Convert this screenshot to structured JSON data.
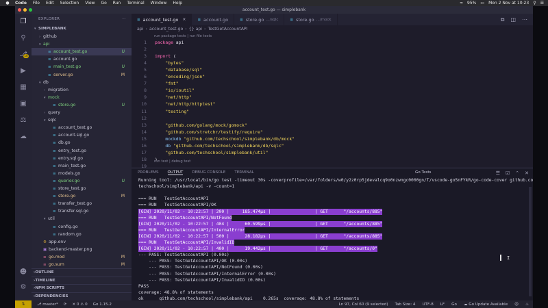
{
  "menubar": {
    "apple_icon": "apple-icon",
    "items": [
      "Code",
      "File",
      "Edit",
      "Selection",
      "View",
      "Go",
      "Run",
      "Terminal",
      "Window",
      "Help"
    ],
    "clock": "Mon 2 Nov at 10:23",
    "battery": "95%"
  },
  "window": {
    "title": "account_test.go — simplebank"
  },
  "sidebar": {
    "title": "EXPLORER",
    "project": "SIMPLEBANK",
    "rows": [
      {
        "label": "github",
        "kind": "folder",
        "open": false,
        "depth": 1,
        "status": ""
      },
      {
        "label": "api",
        "kind": "folder",
        "open": true,
        "depth": 1,
        "status": "",
        "color": "#7fd17f"
      },
      {
        "label": "account_test.go",
        "kind": "go",
        "open": false,
        "depth": 2,
        "status": "U",
        "color": "#7fd17f",
        "selected": true
      },
      {
        "label": "account.go",
        "kind": "go",
        "open": false,
        "depth": 2,
        "status": ""
      },
      {
        "label": "main_test.go",
        "kind": "go",
        "open": false,
        "depth": 2,
        "status": "U",
        "color": "#7fd17f"
      },
      {
        "label": "server.go",
        "kind": "go",
        "open": false,
        "depth": 2,
        "status": "M",
        "color": "#e2c08d"
      },
      {
        "label": "db",
        "kind": "folder",
        "open": true,
        "depth": 1,
        "status": ""
      },
      {
        "label": "migration",
        "kind": "folder",
        "open": false,
        "depth": 2,
        "status": ""
      },
      {
        "label": "mock",
        "kind": "folder",
        "open": true,
        "depth": 2,
        "status": "",
        "color": "#7fd17f"
      },
      {
        "label": "store.go",
        "kind": "go",
        "open": false,
        "depth": 3,
        "status": "U",
        "color": "#7fd17f"
      },
      {
        "label": "query",
        "kind": "folder",
        "open": false,
        "depth": 2,
        "status": ""
      },
      {
        "label": "sqlc",
        "kind": "folder",
        "open": true,
        "depth": 2,
        "status": ""
      },
      {
        "label": "account_test.go",
        "kind": "go",
        "open": false,
        "depth": 3,
        "status": ""
      },
      {
        "label": "account.sql.go",
        "kind": "go",
        "open": false,
        "depth": 3,
        "status": ""
      },
      {
        "label": "db.go",
        "kind": "go",
        "open": false,
        "depth": 3,
        "status": ""
      },
      {
        "label": "entry_test.go",
        "kind": "go",
        "open": false,
        "depth": 3,
        "status": ""
      },
      {
        "label": "entry.sql.go",
        "kind": "go",
        "open": false,
        "depth": 3,
        "status": ""
      },
      {
        "label": "main_test.go",
        "kind": "go",
        "open": false,
        "depth": 3,
        "status": ""
      },
      {
        "label": "models.go",
        "kind": "go",
        "open": false,
        "depth": 3,
        "status": ""
      },
      {
        "label": "querier.go",
        "kind": "go",
        "open": false,
        "depth": 3,
        "status": "U",
        "color": "#7fd17f"
      },
      {
        "label": "store_test.go",
        "kind": "go",
        "open": false,
        "depth": 3,
        "status": ""
      },
      {
        "label": "store.go",
        "kind": "go",
        "open": false,
        "depth": 3,
        "status": "M",
        "color": "#e2c08d"
      },
      {
        "label": "transfer_test.go",
        "kind": "go",
        "open": false,
        "depth": 3,
        "status": ""
      },
      {
        "label": "transfer.sql.go",
        "kind": "go",
        "open": false,
        "depth": 3,
        "status": ""
      },
      {
        "label": "util",
        "kind": "folder",
        "open": true,
        "depth": 2,
        "status": ""
      },
      {
        "label": "config.go",
        "kind": "go",
        "open": false,
        "depth": 3,
        "status": ""
      },
      {
        "label": "random.go",
        "kind": "go",
        "open": false,
        "depth": 3,
        "status": ""
      },
      {
        "label": "app.env",
        "kind": "env",
        "open": false,
        "depth": 1,
        "status": ""
      },
      {
        "label": "backend-master.png",
        "kind": "img",
        "open": false,
        "depth": 1,
        "status": ""
      },
      {
        "label": "go.mod",
        "kind": "mod",
        "open": false,
        "depth": 1,
        "status": "M",
        "color": "#e2c08d"
      },
      {
        "label": "go.sum",
        "kind": "mod",
        "open": false,
        "depth": 1,
        "status": "M",
        "color": "#e2c08d"
      }
    ],
    "sections": [
      "OUTLINE",
      "TIMELINE",
      "NPM SCRIPTS",
      "DEPENDENCIES"
    ]
  },
  "tabs": [
    {
      "label": "account_test.go",
      "path": "",
      "active": true
    },
    {
      "label": "account.go",
      "path": "",
      "active": false
    },
    {
      "label": "store.go",
      "path": ".../sqlc",
      "active": false
    },
    {
      "label": "store.go",
      "path": ".../mock",
      "active": false
    }
  ],
  "breadcrumb": [
    "api",
    "account_test.go",
    "{} api",
    "TestGetAccountAPI"
  ],
  "editor": {
    "lens_top": "run package tests | run file tests",
    "lens_bottom": "run test | debug test",
    "lines": [
      {
        "n": "1",
        "parts": [
          [
            "kw",
            "package "
          ],
          [
            "pl",
            "api"
          ]
        ]
      },
      {
        "n": "2",
        "parts": []
      },
      {
        "n": "3",
        "parts": [
          [
            "kw",
            "import "
          ],
          [
            "pl",
            "("
          ]
        ]
      },
      {
        "n": "4",
        "parts": [
          [
            "str",
            "    \"bytes\""
          ]
        ]
      },
      {
        "n": "5",
        "parts": [
          [
            "str",
            "    \"database/sql\""
          ]
        ]
      },
      {
        "n": "6",
        "parts": [
          [
            "str",
            "    \"encoding/json\""
          ]
        ]
      },
      {
        "n": "7",
        "parts": [
          [
            "str",
            "    \"fmt\""
          ]
        ]
      },
      {
        "n": "8",
        "parts": [
          [
            "str",
            "    \"io/ioutil\""
          ]
        ]
      },
      {
        "n": "9",
        "parts": [
          [
            "str",
            "    \"net/http\""
          ]
        ]
      },
      {
        "n": "10",
        "parts": [
          [
            "str",
            "    \"net/http/httptest\""
          ]
        ]
      },
      {
        "n": "11",
        "parts": [
          [
            "str",
            "    \"testing\""
          ]
        ]
      },
      {
        "n": "12",
        "parts": []
      },
      {
        "n": "13",
        "parts": [
          [
            "str",
            "    \"github.com/golang/mock/gomock\""
          ]
        ]
      },
      {
        "n": "14",
        "parts": [
          [
            "str",
            "    \"github.com/stretchr/testify/require\""
          ]
        ]
      },
      {
        "n": "15",
        "parts": [
          [
            "id",
            "    mockdb "
          ],
          [
            "str",
            "\"github.com/techschool/simplebank/db/mock\""
          ]
        ]
      },
      {
        "n": "16",
        "parts": [
          [
            "id",
            "    db "
          ],
          [
            "str",
            "\"github.com/techschool/simplebank/db/sqlc\""
          ]
        ]
      },
      {
        "n": "17",
        "parts": [
          [
            "str",
            "    \"github.com/techschool/simplebank/util\""
          ]
        ]
      },
      {
        "n": "18",
        "parts": [
          [
            "pl",
            ")"
          ]
        ]
      },
      {
        "n": "19",
        "parts": []
      }
    ]
  },
  "panel": {
    "tabs": [
      "PROBLEMS",
      "OUTPUT",
      "DEBUG CONSOLE",
      "TERMINAL"
    ],
    "active_tab": "OUTPUT",
    "task": "Go Tests",
    "lines": [
      {
        "t": "Running tool: /usr/local/bin/go test -timeout 30s -coverprofile=/var/folders/w0/y2z0rp5jdevalcq9o0nzwngc0000gn/T/vscode-go5nFYkR/go-code-cover github.com/",
        "hl": false
      },
      {
        "t": "techschool/simplebank/api -v -count=1",
        "hl": false
      },
      {
        "t": "",
        "hl": false
      },
      {
        "t": "=== RUN   TestGetAccountAPI",
        "hl": false
      },
      {
        "t": "=== RUN   TestGetAccountAPI/OK",
        "hl": false
      },
      {
        "t": "[GIN] 2020/11/02 - 10:22:57 | 200 |     185.474µs |                 | GET      \"/accounts/885\"",
        "hl": true
      },
      {
        "t": "=== RUN   TestGetAccountAPI/NotFound",
        "hl": true
      },
      {
        "t": "[GIN] 2020/11/02 - 10:22:57 | 404 |      60.599µs |                 | GET      \"/accounts/885\"",
        "hl": true
      },
      {
        "t": "=== RUN   TestGetAccountAPI/InternalError",
        "hl": true
      },
      {
        "t": "[GIN] 2020/11/02 - 10:22:57 | 500 |      28.182µs |                 | GET      \"/accounts/885\"",
        "hl": true
      },
      {
        "t": "=== RUN   TestGetAccountAPI/InvalidID",
        "hl": true
      },
      {
        "t": "[GIN] 2020/11/02 - 10:22:57 | 400 |      19.442µs |                 | GET      \"/accounts/0\"",
        "hl": true
      },
      {
        "t": "--- PASS: TestGetAccountAPI (0.00s)",
        "hl": false
      },
      {
        "t": "    --- PASS: TestGetAccountAPI/OK (0.00s)",
        "hl": false
      },
      {
        "t": "    --- PASS: TestGetAccountAPI/NotFound (0.00s)",
        "hl": false
      },
      {
        "t": "    --- PASS: TestGetAccountAPI/InternalError (0.00s)",
        "hl": false
      },
      {
        "t": "    --- PASS: TestGetAccountAPI/InvalidID (0.00s)",
        "hl": false
      },
      {
        "t": "PASS",
        "hl": false
      },
      {
        "t": "coverage: 48.8% of statements",
        "hl": false
      },
      {
        "t": "ok      github.com/techschool/simplebank/api    0.265s  coverage: 48.8% of statements",
        "hl": false
      }
    ]
  },
  "statusbar": {
    "branch": "master*",
    "sync": "⟳",
    "errors": "0",
    "warnings": "0",
    "go_version": "Go 1.15.2",
    "position": "Ln 97, Col 60 (9 selected)",
    "tab_size": "Tab Size: 4",
    "encoding": "UTF-8",
    "eol": "LF",
    "language": "Go",
    "update": "Go Update Available"
  },
  "colors": {
    "accent": "#8a3ed0",
    "statusbar_remote": "#c5a100",
    "added": "#7fd17f",
    "modified": "#e2c08d"
  }
}
